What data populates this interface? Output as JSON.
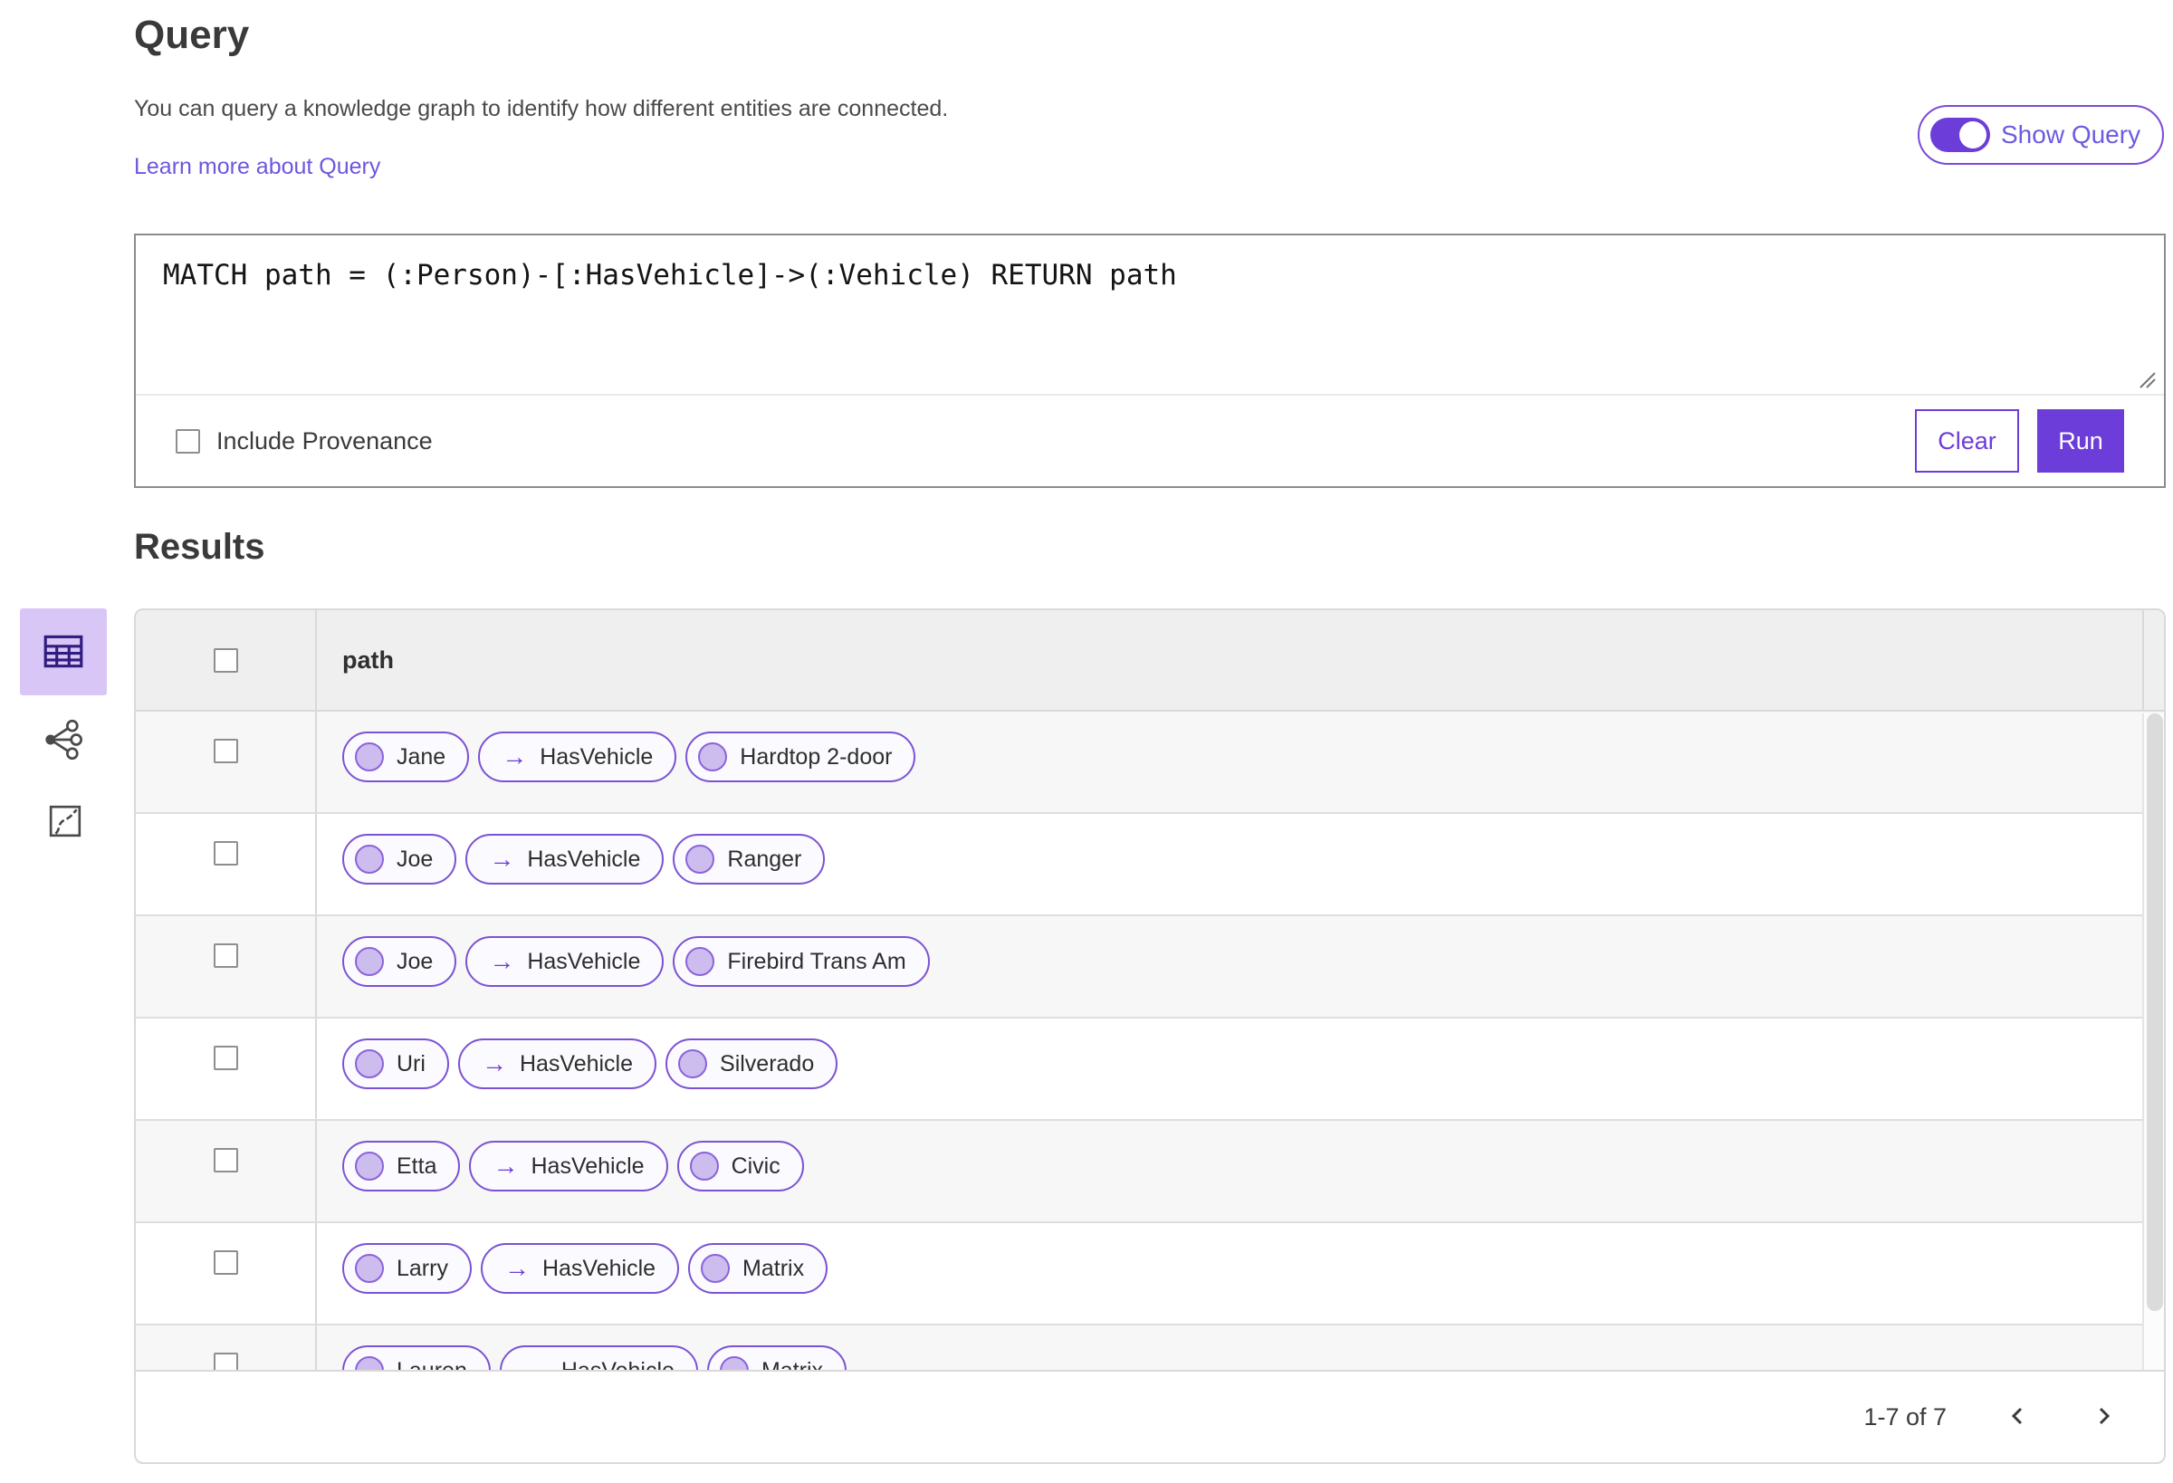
{
  "header": {
    "title": "Query",
    "description": "You can query a knowledge graph to identify how different entities are connected.",
    "learn_more_label": "Learn more about Query",
    "show_query_label": "Show Query",
    "show_query_on": true
  },
  "query_editor": {
    "query_text": "MATCH path = (:Person)-[:HasVehicle]->(:Vehicle) RETURN path",
    "include_provenance_label": "Include Provenance",
    "include_provenance_checked": false,
    "clear_label": "Clear",
    "run_label": "Run"
  },
  "results": {
    "title": "Results",
    "column_header": "path",
    "arrow_glyph": "→",
    "view_switcher": [
      {
        "name": "table-view-icon",
        "active": true
      },
      {
        "name": "graph-view-icon",
        "active": false
      },
      {
        "name": "map-view-icon",
        "active": false
      }
    ],
    "rows": [
      {
        "person": "Jane",
        "relationship": "HasVehicle",
        "vehicle": "Hardtop 2-door"
      },
      {
        "person": "Joe",
        "relationship": "HasVehicle",
        "vehicle": "Ranger"
      },
      {
        "person": "Joe",
        "relationship": "HasVehicle",
        "vehicle": "Firebird Trans Am"
      },
      {
        "person": "Uri",
        "relationship": "HasVehicle",
        "vehicle": "Silverado"
      },
      {
        "person": "Etta",
        "relationship": "HasVehicle",
        "vehicle": "Civic"
      },
      {
        "person": "Larry",
        "relationship": "HasVehicle",
        "vehicle": "Matrix"
      },
      {
        "person": "Lauren",
        "relationship": "HasVehicle",
        "vehicle": "Matrix"
      }
    ],
    "pagination": {
      "range_label": "1-7 of 7",
      "prev_icon": "chevron-left-icon",
      "next_icon": "chevron-right-icon"
    }
  },
  "colors": {
    "brand_purple": "#6C3DD8",
    "chip_border": "#7B52D4",
    "chip_fill": "#FBFAFE",
    "node_circle_fill": "#CDBCEE",
    "active_view_bg": "#D8C6F6",
    "link": "#6F56DD",
    "table_border": "#D9D9D9",
    "header_row_bg": "#F0EFEF",
    "alt_row_bg": "#F7F7F7"
  }
}
